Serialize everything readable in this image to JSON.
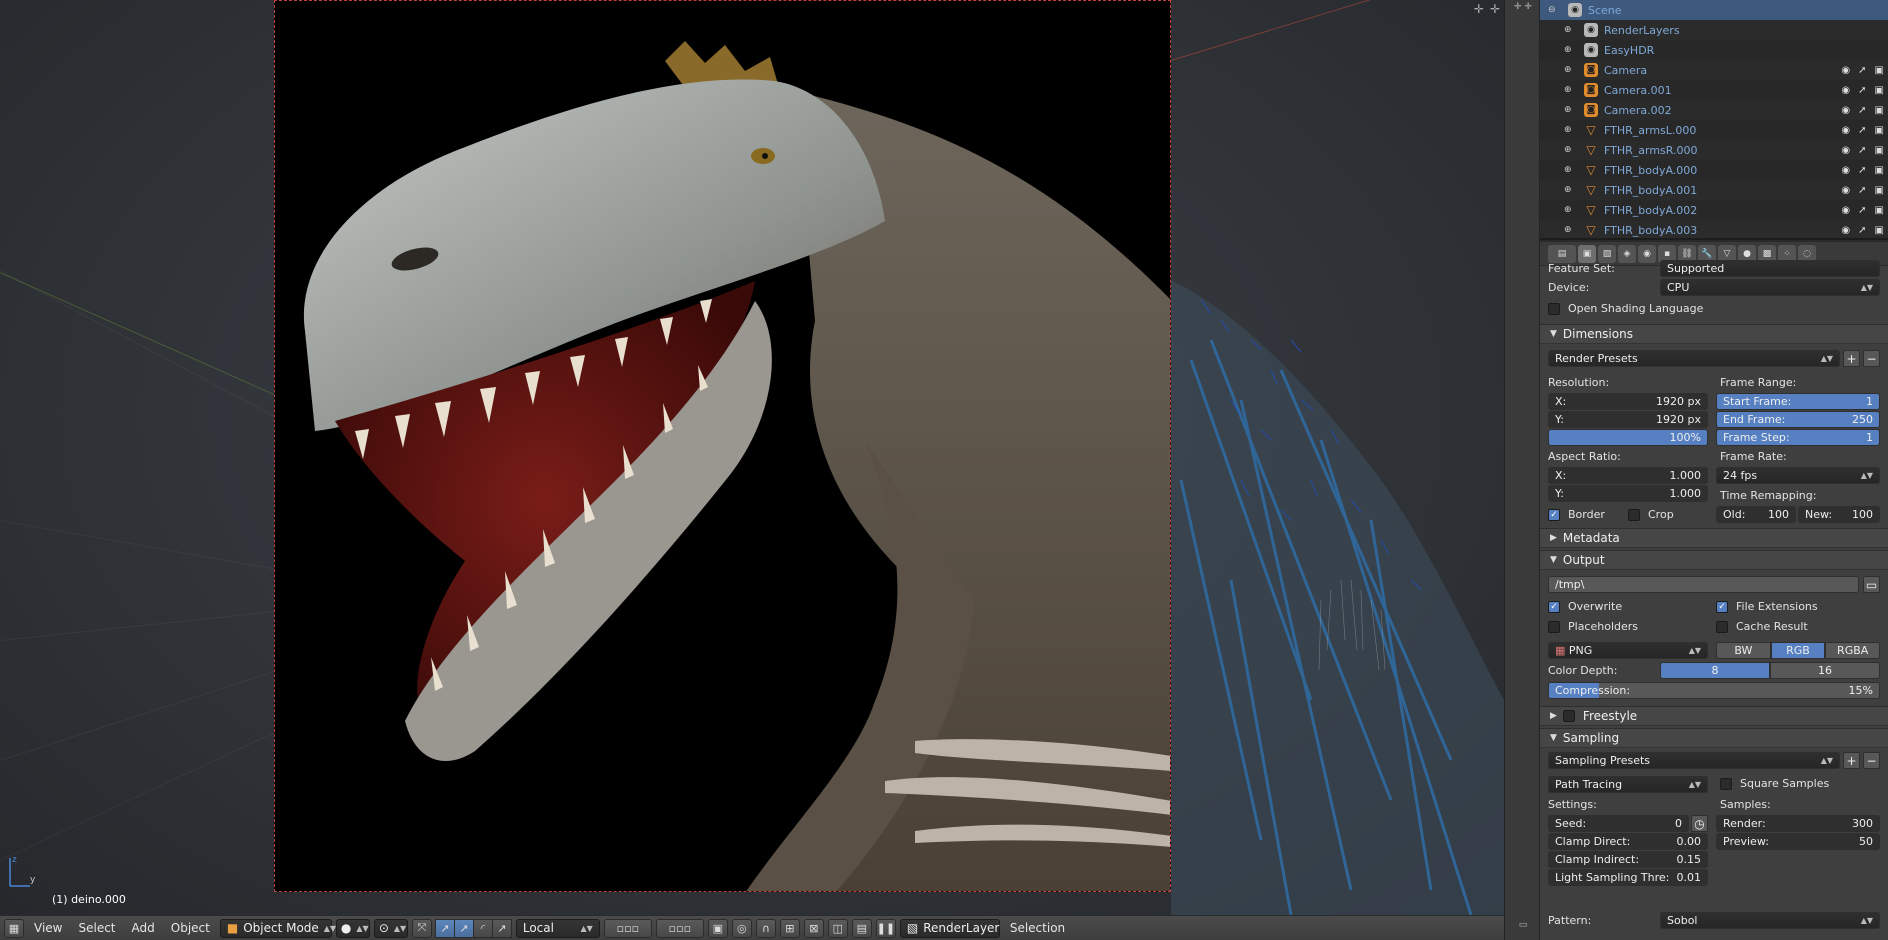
{
  "viewport": {
    "object_label": "(1) deino.000",
    "axis_z": "z",
    "axis_y": "y"
  },
  "header": {
    "menus": [
      "View",
      "Select",
      "Add",
      "Object"
    ],
    "mode": "Object Mode",
    "pivot": "Local",
    "render_layer": "RenderLayer",
    "selection": "Selection"
  },
  "outliner": {
    "rows": [
      {
        "name": "Scene",
        "icon": "scene-icon",
        "color": "#b8b8b8",
        "selected": true
      },
      {
        "name": "RenderLayers",
        "icon": "render-layers-icon",
        "color": "#b8b8b8"
      },
      {
        "name": "EasyHDR",
        "icon": "world-icon",
        "color": "#b8b8b8"
      },
      {
        "name": "Camera",
        "icon": "camera-icon",
        "color": "#e08a2e"
      },
      {
        "name": "Camera.001",
        "icon": "camera-icon",
        "color": "#e08a2e"
      },
      {
        "name": "Camera.002",
        "icon": "camera-icon",
        "color": "#e08a2e"
      },
      {
        "name": "FTHR_armsL.000",
        "icon": "mesh-icon",
        "color": "#e08a2e"
      },
      {
        "name": "FTHR_armsR.000",
        "icon": "mesh-icon",
        "color": "#e08a2e"
      },
      {
        "name": "FTHR_bodyA.000",
        "icon": "mesh-icon",
        "color": "#e08a2e"
      },
      {
        "name": "FTHR_bodyA.001",
        "icon": "mesh-icon",
        "color": "#e08a2e"
      },
      {
        "name": "FTHR_bodyA.002",
        "icon": "mesh-icon",
        "color": "#e08a2e"
      },
      {
        "name": "FTHR_bodyA.003",
        "icon": "mesh-icon",
        "color": "#e08a2e"
      }
    ]
  },
  "render": {
    "feature_set_partial": "Feature Set:",
    "feature_set_value_partial": "Supported",
    "device_label": "Device:",
    "device_value": "CPU",
    "osl_label": "Open Shading Language",
    "dimensions": {
      "title": "Dimensions",
      "presets": "Render Presets",
      "resolution_label": "Resolution:",
      "res_x_label": "X:",
      "res_x": "1920 px",
      "res_y_label": "Y:",
      "res_y": "1920 px",
      "res_pct": "100%",
      "aspect_label": "Aspect Ratio:",
      "asp_x_label": "X:",
      "asp_x": "1.000",
      "asp_y_label": "Y:",
      "asp_y": "1.000",
      "border": "Border",
      "crop": "Crop",
      "frame_range_label": "Frame Range:",
      "start_label": "Start Frame:",
      "start": "1",
      "end_label": "End Frame:",
      "end": "250",
      "step_label": "Frame Step:",
      "step": "1",
      "frame_rate_label": "Frame Rate:",
      "frame_rate": "24 fps",
      "time_remap_label": "Time Remapping:",
      "old_label": "Old:",
      "old": "100",
      "new_label": "New:",
      "new": "100"
    },
    "metadata_title": "Metadata",
    "output": {
      "title": "Output",
      "path": "/tmp\\",
      "overwrite": "Overwrite",
      "file_ext": "File Extensions",
      "placeholders": "Placeholders",
      "cache_result": "Cache Result",
      "format": "PNG",
      "bw": "BW",
      "rgb": "RGB",
      "rgba": "RGBA",
      "color_depth_label": "Color Depth:",
      "depth_8": "8",
      "depth_16": "16",
      "compression_label": "Compression:",
      "compression": "15%",
      "compression_value": 0.15
    },
    "freestyle_title": "Freestyle",
    "sampling": {
      "title": "Sampling",
      "presets": "Sampling Presets",
      "integrator": "Path Tracing",
      "square_samples": "Square Samples",
      "settings_label": "Settings:",
      "seed_label": "Seed:",
      "seed": "0",
      "clamp_direct_label": "Clamp Direct:",
      "clamp_direct": "0.00",
      "clamp_indirect_label": "Clamp Indirect:",
      "clamp_indirect": "0.15",
      "light_thr_label": "Light Sampling Thre:",
      "light_thr": "0.01",
      "samples_label": "Samples:",
      "render_label": "Render:",
      "render": "300",
      "preview_label": "Preview:",
      "preview": "50",
      "pattern_label": "Pattern:",
      "pattern": "Sobol"
    }
  }
}
